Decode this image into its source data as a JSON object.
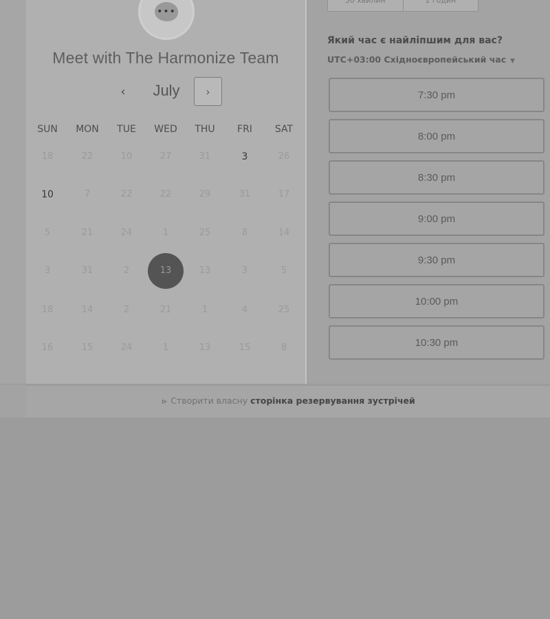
{
  "panel": {
    "title": "Meet with The Harmonize Team",
    "month": "July"
  },
  "days_of_week": [
    "SUN",
    "MON",
    "TUE",
    "WED",
    "THU",
    "FRI",
    "SAT"
  ],
  "calendar_rows": [
    [
      "18",
      "22",
      "10",
      "27",
      "31",
      "3",
      "26"
    ],
    [
      "10",
      "7",
      "22",
      "22",
      "29",
      "31",
      "17"
    ],
    [
      "5",
      "21",
      "24",
      "1",
      "25",
      "8",
      "14"
    ],
    [
      "3",
      "31",
      "2",
      "13",
      "13",
      "3",
      "5"
    ],
    [
      "18",
      "14",
      "2",
      "21",
      "1",
      "4",
      "25"
    ],
    [
      "16",
      "15",
      "24",
      "1",
      "13",
      "15",
      "8"
    ]
  ],
  "calendar_dark_cells": [
    [
      0,
      5
    ],
    [
      1,
      0
    ]
  ],
  "calendar_selected": [
    3,
    3
  ],
  "duration_tabs": [
    "30 хвилин",
    "1 годин"
  ],
  "booking": {
    "question": "Який час є найліпшим для вас?",
    "timezone": "UTC+03:00 Східноєвропейський час"
  },
  "time_slots": [
    "7:30 pm",
    "8:00 pm",
    "8:30 pm",
    "9:00 pm",
    "9:30 pm",
    "10:00 pm",
    "10:30 pm"
  ],
  "footer": {
    "prefix": "Створити власну",
    "link": "сторінка резервування зустрічей"
  },
  "icons": {
    "prev": "chevron-left-icon",
    "next": "chevron-right-icon",
    "timezone_caret": "caret-down-icon",
    "avatar": "chat-bubble-icon"
  }
}
